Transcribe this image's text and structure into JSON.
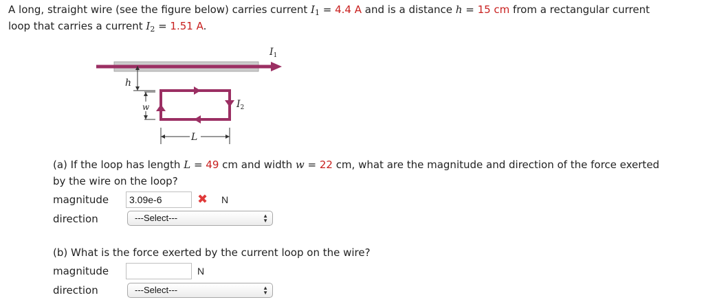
{
  "problem": {
    "line1_pre": "A long, straight wire (see the figure below) carries current ",
    "I1_sym": "I",
    "I1_sub": "1",
    "eq": " = ",
    "I1_val": "4.4 A",
    "line1_mid": " and is a distance ",
    "h_sym": "h",
    "h_val": "15 cm",
    "line1_post": " from a rectangular current",
    "line2_pre": "loop that carries a current ",
    "I2_sym": "I",
    "I2_sub": "2",
    "I2_val": "1.51 A",
    "line2_post": "."
  },
  "figure": {
    "I1_label": "I",
    "I1_sub": "1",
    "I2_label": "I",
    "I2_sub": "2",
    "h_label": "h",
    "w_label": "w",
    "L_label": "L",
    "colors": {
      "wire": "#9b2f63",
      "rod": "#cccccc",
      "dim": "#333333"
    }
  },
  "part_a": {
    "q_pre": "(a) If the loop has length ",
    "L_sym": "L",
    "eq": " = ",
    "L_val": "49",
    "L_unit": " cm and width ",
    "w_sym": "w",
    "w_val": "22",
    "q_mid": " cm, what are the magnitude and direction of the force exerted",
    "q_line2": "by the wire on the loop?",
    "magnitude_label": "magnitude",
    "magnitude_value": "3.09e-6",
    "wrong_mark": "✖",
    "unit": "N",
    "direction_label": "direction",
    "direction_select": "---Select---"
  },
  "part_b": {
    "question": "(b) What is the force exerted by the current loop on the wire?",
    "magnitude_label": "magnitude",
    "magnitude_value": "",
    "unit": "N",
    "direction_label": "direction",
    "direction_select": "---Select---"
  }
}
